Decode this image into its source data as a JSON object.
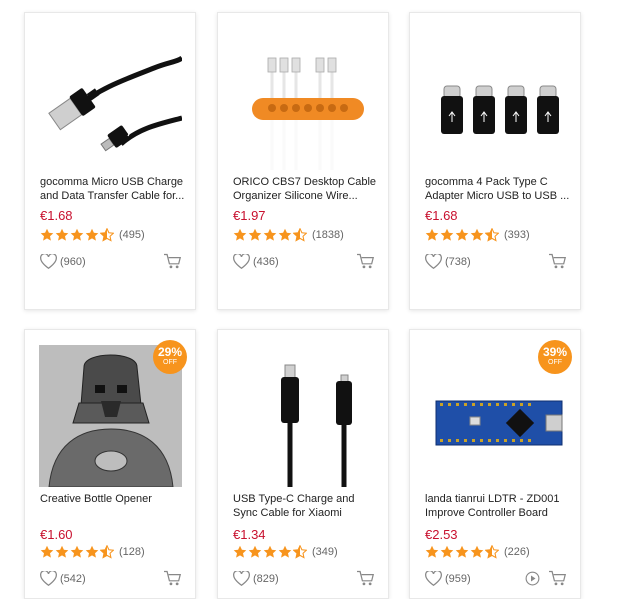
{
  "products": [
    {
      "title": "gocomma Micro USB Charge and Data Transfer Cable for...",
      "price": "€1.68",
      "rating_count": "(495)",
      "wishlist_count": "(960)",
      "rating": 4.5
    },
    {
      "title": "ORICO CBS7 Desktop Cable Organizer Silicone Wire...",
      "price": "€1.97",
      "rating_count": "(1838)",
      "wishlist_count": "(436)",
      "rating": 4.5
    },
    {
      "title": "gocomma 4 Pack Type C Adapter Micro USB to USB ...",
      "price": "€1.68",
      "rating_count": "(393)",
      "wishlist_count": "(738)",
      "rating": 4.5
    },
    {
      "title": "Creative Bottle Opener",
      "price": "€1.60",
      "rating_count": "(128)",
      "wishlist_count": "(542)",
      "rating": 4.5,
      "badge": {
        "pct": "29%",
        "off": "OFF"
      }
    },
    {
      "title": "USB Type-C Charge and Sync Cable for Xiaomi",
      "price": "€1.34",
      "rating_count": "(349)",
      "wishlist_count": "(829)",
      "rating": 4.5
    },
    {
      "title": "landa tianrui LDTR - ZD001 Improve Controller Board",
      "price": "€2.53",
      "rating_count": "(226)",
      "wishlist_count": "(959)",
      "rating": 4.5,
      "badge": {
        "pct": "39%",
        "off": "OFF"
      }
    }
  ],
  "icons": {
    "wishlist": "heart-icon",
    "cart": "cart-icon",
    "video": "play-video-icon",
    "rating": "star-icon"
  },
  "colors": {
    "price": "#c8102e",
    "star": "#f7941d",
    "badge": "#f7941d"
  }
}
